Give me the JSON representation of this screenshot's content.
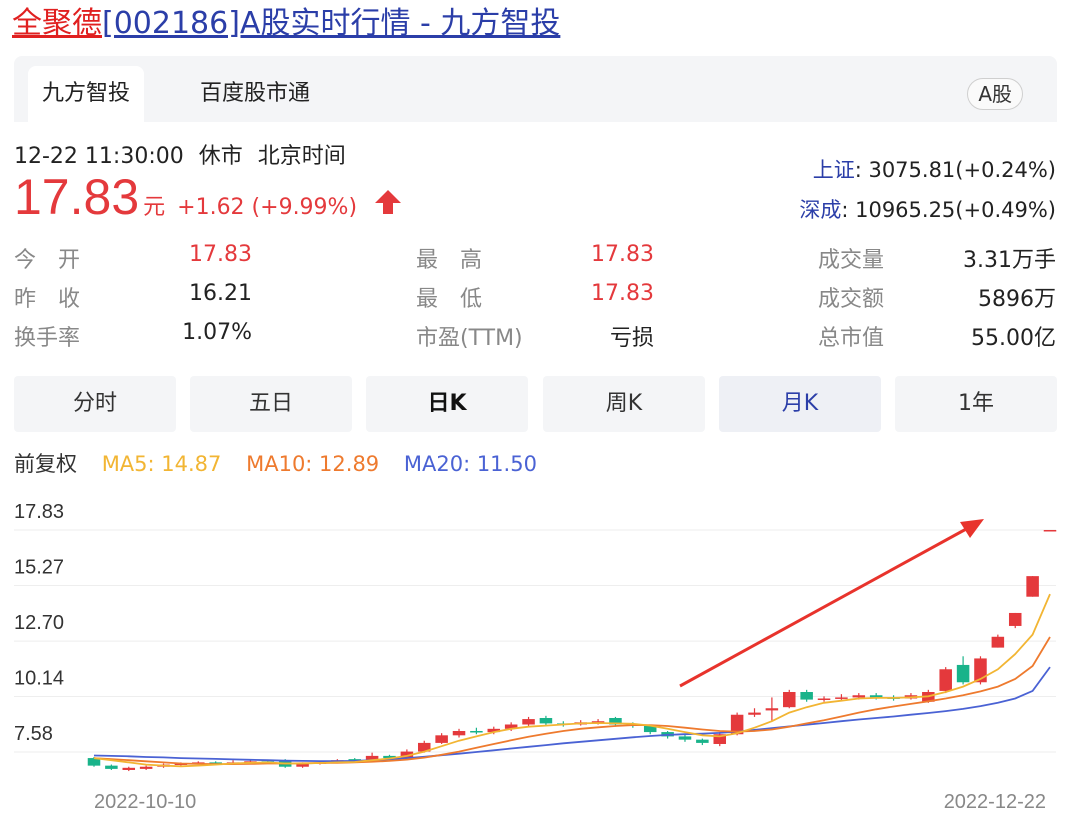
{
  "page": {
    "title_name": "全聚德",
    "title_rest": "[002186]A股实时行情 - 九方智投"
  },
  "source_tabs": [
    "九方智投",
    "百度股市通"
  ],
  "market_badge": "A股",
  "status": {
    "datetime": "12-22 11:30:00",
    "state": "休市",
    "timezone": "北京时间"
  },
  "quote": {
    "price": "17.83",
    "unit": "元",
    "change": "+1.62 (+9.99%)"
  },
  "indices": [
    {
      "label": "上证",
      "value": ": 3075.81(+0.24%)"
    },
    {
      "label": "深成",
      "value": ": 10965.25(+0.49%)"
    }
  ],
  "stats": [
    {
      "label": "今　开",
      "value": "17.83",
      "red": true
    },
    {
      "label": "最　高",
      "value": "17.83",
      "red": true
    },
    {
      "label": "成交量",
      "value": "3.31万手",
      "red": false
    },
    {
      "label": "昨　收",
      "value": "16.21",
      "red": false
    },
    {
      "label": "最　低",
      "value": "17.83",
      "red": true
    },
    {
      "label": "成交额",
      "value": "5896万",
      "red": false
    },
    {
      "label": "换手率",
      "value": "1.07%",
      "red": false
    },
    {
      "label": "市盈(TTM)",
      "value": "亏损",
      "red": false
    },
    {
      "label": "总市值",
      "value": "55.00亿",
      "red": false
    }
  ],
  "period_tabs": [
    "分时",
    "五日",
    "日K",
    "周K",
    "月K",
    "1年"
  ],
  "ma": {
    "adjust": "前复权",
    "ma5": "MA5: 14.87",
    "ma10": "MA10: 12.89",
    "ma20": "MA20: 11.50"
  },
  "colors": {
    "up": "#e4393c",
    "down": "#19b38a",
    "ma5": "#f2b533",
    "ma10": "#ee7a2e",
    "ma20": "#4a62d4",
    "link": "#2b3ea8"
  },
  "chart_data": {
    "type": "candlestick",
    "x_start_label": "2022-10-10",
    "x_end_label": "2022-12-22",
    "y_tick_labels": [
      "17.83",
      "15.27",
      "12.70",
      "10.14",
      "7.58"
    ],
    "ylim": [
      7.58,
      17.83
    ],
    "grid": true,
    "annotation": "red arrow pointing up-right",
    "candles": [
      {
        "o": 7.3,
        "c": 6.95,
        "h": 7.35,
        "l": 6.9
      },
      {
        "o": 6.95,
        "c": 6.8,
        "h": 7.0,
        "l": 6.75
      },
      {
        "o": 6.75,
        "c": 6.85,
        "h": 6.9,
        "l": 6.7
      },
      {
        "o": 6.8,
        "c": 6.9,
        "h": 6.95,
        "l": 6.75
      },
      {
        "o": 6.9,
        "c": 7.0,
        "h": 7.05,
        "l": 6.85
      },
      {
        "o": 7.0,
        "c": 7.05,
        "h": 7.1,
        "l": 6.95
      },
      {
        "o": 7.05,
        "c": 7.1,
        "h": 7.15,
        "l": 7.0
      },
      {
        "o": 7.1,
        "c": 7.05,
        "h": 7.15,
        "l": 7.0
      },
      {
        "o": 7.05,
        "c": 7.1,
        "h": 7.2,
        "l": 7.0
      },
      {
        "o": 7.1,
        "c": 7.15,
        "h": 7.25,
        "l": 7.05
      },
      {
        "o": 7.15,
        "c": 7.1,
        "h": 7.2,
        "l": 7.05
      },
      {
        "o": 7.2,
        "c": 6.9,
        "h": 7.25,
        "l": 6.85
      },
      {
        "o": 6.9,
        "c": 7.05,
        "h": 7.1,
        "l": 6.85
      },
      {
        "o": 7.05,
        "c": 7.1,
        "h": 7.15,
        "l": 7.0
      },
      {
        "o": 7.1,
        "c": 7.2,
        "h": 7.25,
        "l": 7.05
      },
      {
        "o": 7.25,
        "c": 7.2,
        "h": 7.3,
        "l": 7.15
      },
      {
        "o": 7.2,
        "c": 7.4,
        "h": 7.55,
        "l": 7.15
      },
      {
        "o": 7.4,
        "c": 7.3,
        "h": 7.45,
        "l": 7.2
      },
      {
        "o": 7.3,
        "c": 7.6,
        "h": 7.7,
        "l": 7.25
      },
      {
        "o": 7.6,
        "c": 8.0,
        "h": 8.1,
        "l": 7.55
      },
      {
        "o": 8.0,
        "c": 8.35,
        "h": 8.45,
        "l": 7.95
      },
      {
        "o": 8.35,
        "c": 8.55,
        "h": 8.65,
        "l": 8.25
      },
      {
        "o": 8.55,
        "c": 8.5,
        "h": 8.7,
        "l": 8.4
      },
      {
        "o": 8.5,
        "c": 8.65,
        "h": 8.75,
        "l": 8.4
      },
      {
        "o": 8.65,
        "c": 8.85,
        "h": 8.95,
        "l": 8.55
      },
      {
        "o": 8.85,
        "c": 9.1,
        "h": 9.2,
        "l": 8.75
      },
      {
        "o": 9.15,
        "c": 8.9,
        "h": 9.25,
        "l": 8.8
      },
      {
        "o": 8.9,
        "c": 8.85,
        "h": 9.0,
        "l": 8.75
      },
      {
        "o": 8.85,
        "c": 8.95,
        "h": 9.05,
        "l": 8.8
      },
      {
        "o": 8.95,
        "c": 9.0,
        "h": 9.1,
        "l": 8.85
      },
      {
        "o": 9.15,
        "c": 8.85,
        "h": 9.2,
        "l": 8.75
      },
      {
        "o": 8.85,
        "c": 8.8,
        "h": 8.95,
        "l": 8.7
      },
      {
        "o": 8.8,
        "c": 8.5,
        "h": 8.85,
        "l": 8.4
      },
      {
        "o": 8.5,
        "c": 8.3,
        "h": 8.55,
        "l": 8.2
      },
      {
        "o": 8.3,
        "c": 8.15,
        "h": 8.4,
        "l": 8.05
      },
      {
        "o": 8.15,
        "c": 8.0,
        "h": 8.2,
        "l": 7.9
      },
      {
        "o": 7.95,
        "c": 8.4,
        "h": 8.5,
        "l": 7.85
      },
      {
        "o": 8.4,
        "c": 9.3,
        "h": 9.4,
        "l": 8.35
      },
      {
        "o": 9.3,
        "c": 9.4,
        "h": 9.6,
        "l": 9.2
      },
      {
        "o": 9.5,
        "c": 9.6,
        "h": 10.1,
        "l": 9.0
      },
      {
        "o": 9.65,
        "c": 10.35,
        "h": 10.45,
        "l": 9.6
      },
      {
        "o": 10.35,
        "c": 10.0,
        "h": 10.45,
        "l": 9.9
      },
      {
        "o": 10.0,
        "c": 10.05,
        "h": 10.15,
        "l": 9.9
      },
      {
        "o": 10.05,
        "c": 10.1,
        "h": 10.25,
        "l": 9.95
      },
      {
        "o": 10.1,
        "c": 10.2,
        "h": 10.3,
        "l": 10.0
      },
      {
        "o": 10.2,
        "c": 10.1,
        "h": 10.3,
        "l": 10.0
      },
      {
        "o": 10.1,
        "c": 10.05,
        "h": 10.2,
        "l": 9.95
      },
      {
        "o": 10.05,
        "c": 10.2,
        "h": 10.3,
        "l": 10.0
      },
      {
        "o": 9.9,
        "c": 10.35,
        "h": 10.45,
        "l": 9.85
      },
      {
        "o": 10.4,
        "c": 11.4,
        "h": 11.5,
        "l": 10.3
      },
      {
        "o": 11.6,
        "c": 10.8,
        "h": 12.0,
        "l": 10.7
      },
      {
        "o": 10.8,
        "c": 11.9,
        "h": 12.0,
        "l": 10.7
      },
      {
        "o": 12.4,
        "c": 12.9,
        "h": 13.0,
        "l": 12.4
      },
      {
        "o": 13.4,
        "c": 14.0,
        "h": 14.0,
        "l": 13.3
      },
      {
        "o": 14.75,
        "c": 15.7,
        "h": 15.7,
        "l": 14.75
      },
      {
        "o": 17.83,
        "c": 17.83,
        "h": 17.83,
        "l": 17.83
      }
    ],
    "ma5_series": [
      7.3,
      7.2,
      7.1,
      7.0,
      6.95,
      6.92,
      6.95,
      7.0,
      7.05,
      7.08,
      7.1,
      7.05,
      7.05,
      7.07,
      7.1,
      7.12,
      7.2,
      7.28,
      7.4,
      7.6,
      7.85,
      8.1,
      8.3,
      8.5,
      8.65,
      8.75,
      8.8,
      8.85,
      8.9,
      8.92,
      8.9,
      8.88,
      8.8,
      8.65,
      8.5,
      8.35,
      8.3,
      8.45,
      8.7,
      9.0,
      9.4,
      9.65,
      9.85,
      9.95,
      10.05,
      10.08,
      10.08,
      10.1,
      10.15,
      10.35,
      10.6,
      10.95,
      11.4,
      12.1,
      13.0,
      14.87
    ],
    "ma10_series": [
      7.3,
      7.25,
      7.2,
      7.15,
      7.1,
      7.05,
      7.03,
      7.02,
      7.02,
      7.03,
      7.05,
      7.05,
      7.06,
      7.07,
      7.08,
      7.1,
      7.13,
      7.17,
      7.23,
      7.32,
      7.45,
      7.6,
      7.78,
      7.95,
      8.12,
      8.28,
      8.42,
      8.55,
      8.65,
      8.72,
      8.78,
      8.82,
      8.82,
      8.78,
      8.7,
      8.62,
      8.55,
      8.52,
      8.55,
      8.62,
      8.75,
      8.9,
      9.05,
      9.22,
      9.4,
      9.55,
      9.68,
      9.8,
      9.92,
      10.05,
      10.2,
      10.38,
      10.6,
      10.95,
      11.55,
      12.89
    ],
    "ma20_series": [
      7.42,
      7.4,
      7.38,
      7.35,
      7.33,
      7.3,
      7.28,
      7.26,
      7.24,
      7.22,
      7.2,
      7.18,
      7.17,
      7.16,
      7.16,
      7.17,
      7.2,
      7.24,
      7.3,
      7.36,
      7.43,
      7.5,
      7.58,
      7.66,
      7.74,
      7.82,
      7.9,
      7.98,
      8.05,
      8.12,
      8.19,
      8.26,
      8.32,
      8.37,
      8.4,
      8.43,
      8.46,
      8.52,
      8.6,
      8.68,
      8.76,
      8.84,
      8.92,
      9.0,
      9.08,
      9.15,
      9.22,
      9.3,
      9.38,
      9.47,
      9.57,
      9.7,
      9.85,
      10.05,
      10.4,
      11.5
    ]
  }
}
